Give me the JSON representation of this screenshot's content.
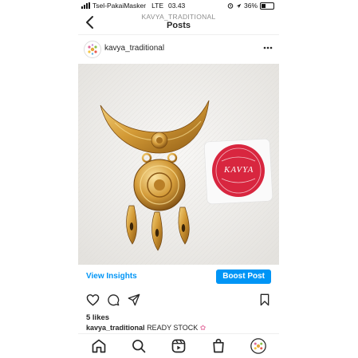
{
  "status_bar": {
    "carrier": "Tsel-PakaiMasker",
    "network": "LTE",
    "time": "03.43",
    "battery": "36%",
    "battery_level": 0.36
  },
  "header": {
    "subtitle": "KAVYA_TRADITIONAL",
    "title": "Posts"
  },
  "post": {
    "username": "kavya_traditional",
    "sticker": {
      "brand": "KAVYA"
    },
    "view_insights_label": "View Insights",
    "boost_label": "Boost Post",
    "likes": "5 likes",
    "caption_user": "kavya_traditional",
    "caption_text": "READY STOCK"
  },
  "colors": {
    "accent": "#0095f6",
    "sticker_red": "#d8263f"
  },
  "icons": {
    "actions": [
      "heart-icon",
      "comment-icon",
      "share-icon",
      "bookmark-icon"
    ],
    "tabbar": [
      "home-icon",
      "search-icon",
      "reels-icon",
      "shop-icon",
      "profile-avatar"
    ]
  }
}
